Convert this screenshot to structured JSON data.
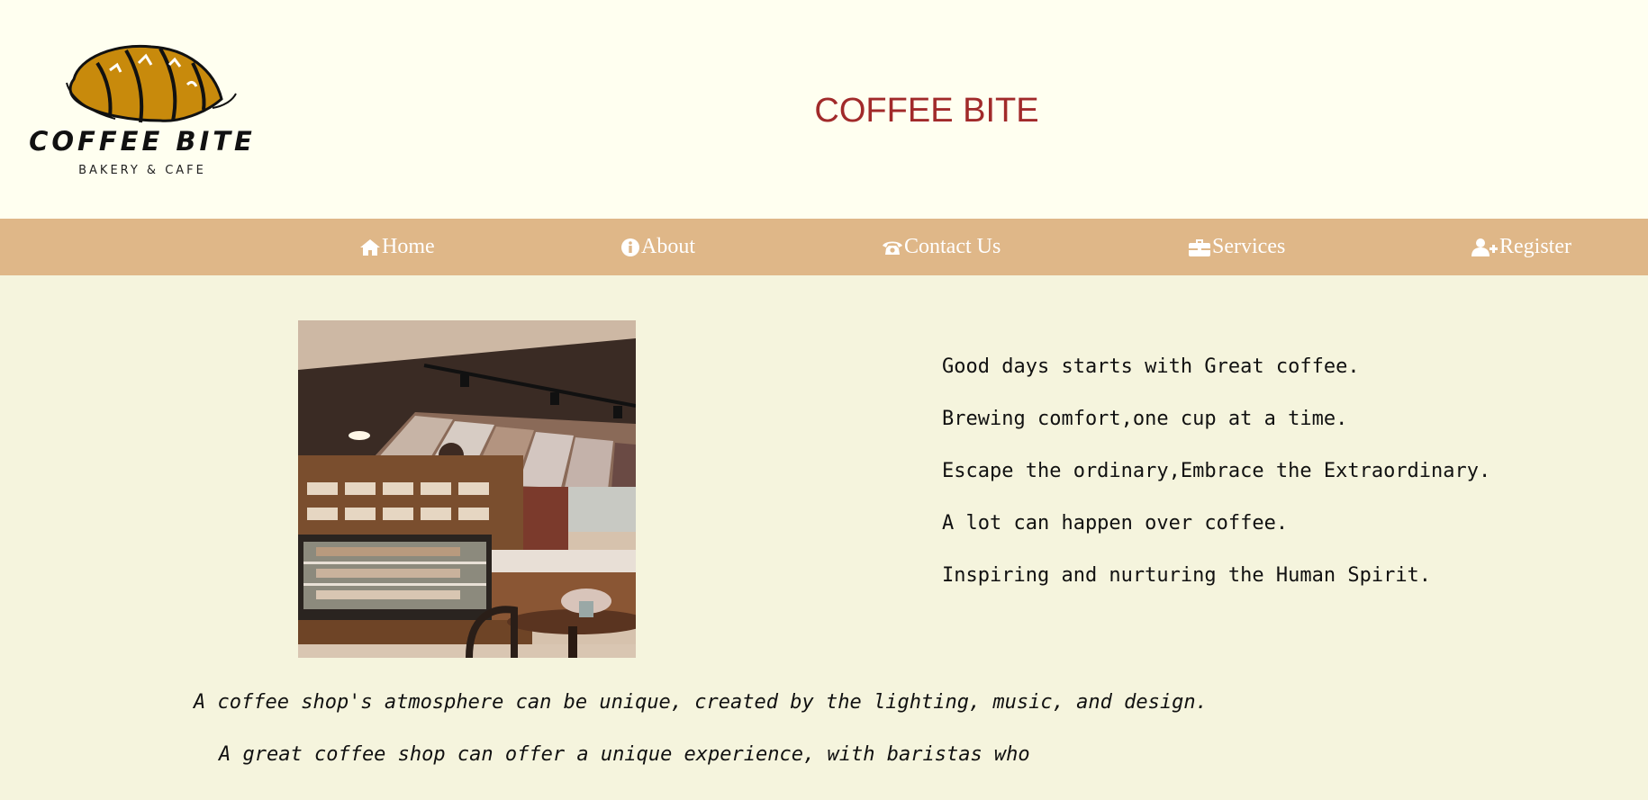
{
  "logo": {
    "wordmark": "COFFEE BITE",
    "tagline": "BAKERY & CAFE",
    "colors": {
      "croissant": "#c88a0c",
      "outline": "#111111"
    }
  },
  "header": {
    "title": "COFFEE BITE",
    "title_color": "#a12a2a",
    "background": "#fffff0"
  },
  "nav": {
    "background": "#dfb788",
    "items": [
      {
        "label": "Home",
        "icon": "home-icon"
      },
      {
        "label": "About",
        "icon": "info-circle-icon"
      },
      {
        "label": "Contact Us",
        "icon": "phone-icon"
      },
      {
        "label": "Services",
        "icon": "briefcase-icon"
      },
      {
        "label": "Register",
        "icon": "user-plus-icon"
      }
    ]
  },
  "main": {
    "background": "#f5f4dd",
    "quotes": [
      "Good days starts with Great coffee.",
      "Brewing comfort,one cup at a time.",
      "Escape the ordinary,Embrace the Extraordinary.",
      "A lot can happen over coffee.",
      "Inspiring and nurturing the Human Spirit."
    ],
    "paragraph_lines": [
      "A coffee shop's atmosphere can be unique, created by the lighting, music, and design.",
      "A great coffee shop can offer a unique experience, with baristas who"
    ]
  }
}
